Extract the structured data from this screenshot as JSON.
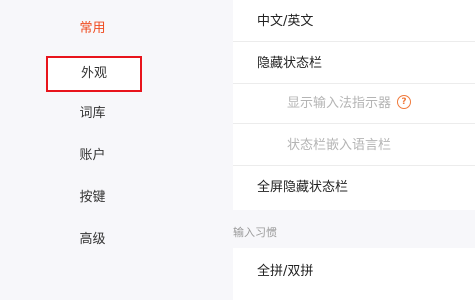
{
  "sidebar": {
    "items": [
      {
        "label": "常用",
        "active": true
      },
      {
        "label": "外观",
        "highlighted": true
      },
      {
        "label": "词库"
      },
      {
        "label": "账户"
      },
      {
        "label": "按键"
      },
      {
        "label": "高级"
      }
    ]
  },
  "content": {
    "rows": [
      {
        "label": "中文/英文"
      },
      {
        "label": "隐藏状态栏"
      },
      {
        "label": "显示输入法指示器",
        "disabled": true,
        "icon": "help-circle-icon"
      },
      {
        "label": "状态栏嵌入语言栏",
        "disabled": true
      },
      {
        "label": "全屏隐藏状态栏"
      }
    ],
    "section_label": "输入习惯",
    "section_rows": [
      {
        "label": "全拼/双拼"
      }
    ]
  },
  "colors": {
    "accent": "#f04a1e",
    "highlight_border": "#e8141c",
    "help_icon": "#f07a3c",
    "disabled_text": "#b4b4b4"
  }
}
